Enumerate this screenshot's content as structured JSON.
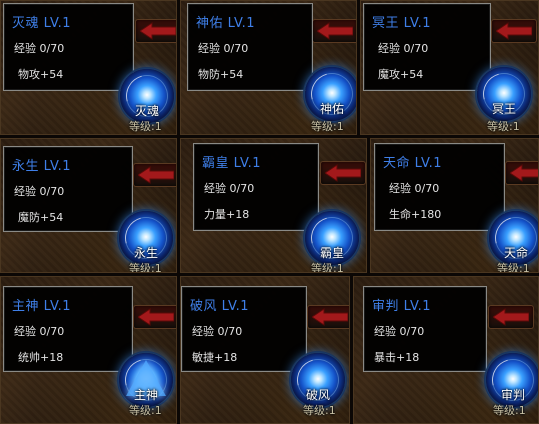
{
  "skills": [
    {
      "name": "灭魂",
      "title": "灭魂 LV.1",
      "exp": "经验 0/70",
      "stat": "物攻+54",
      "level": "等级:1",
      "orb_label": "灭魂"
    },
    {
      "name": "神佑",
      "title": "神佑 LV.1",
      "exp": "经验 0/70",
      "stat": "物防+54",
      "level": "等级:1",
      "orb_label": "神佑"
    },
    {
      "name": "冥王",
      "title": "冥王 LV.1",
      "exp": "经验 0/70",
      "stat": "魔攻+54",
      "level": "等级:1",
      "orb_label": "冥王"
    },
    {
      "name": "永生",
      "title": "永生 LV.1",
      "exp": "经验 0/70",
      "stat": "魔防+54",
      "level": "等级:1",
      "orb_label": "永生"
    },
    {
      "name": "霸皇",
      "title": "霸皇 LV.1",
      "exp": "经验 0/70",
      "stat": "力量+18",
      "level": "等级:1",
      "orb_label": "霸皇"
    },
    {
      "name": "天命",
      "title": "天命 LV.1",
      "exp": "经验 0/70",
      "stat": "生命+180",
      "level": "等级:1",
      "orb_label": "天命"
    },
    {
      "name": "主神",
      "title": "主神 LV.1",
      "exp": "经验 0/70",
      "stat": "统帅+18",
      "level": "等级:1",
      "orb_label": "主神"
    },
    {
      "name": "破风",
      "title": "破风 LV.1",
      "exp": "经验 0/70",
      "stat": "敏捷+18",
      "level": "等级:1",
      "orb_label": "破风"
    },
    {
      "name": "审判",
      "title": "审判 LV.1",
      "exp": "经验 0/70",
      "stat": "暴击+18",
      "level": "等级:1",
      "orb_label": "审判"
    }
  ],
  "colors": {
    "title": "#3f7fe8",
    "text": "#e4e4e4",
    "arrow": "#a3191b",
    "orb": "#2a8cff"
  },
  "icons": {
    "arrow": "red-left-arrow-icon",
    "orb": "skill-orb-icon"
  }
}
